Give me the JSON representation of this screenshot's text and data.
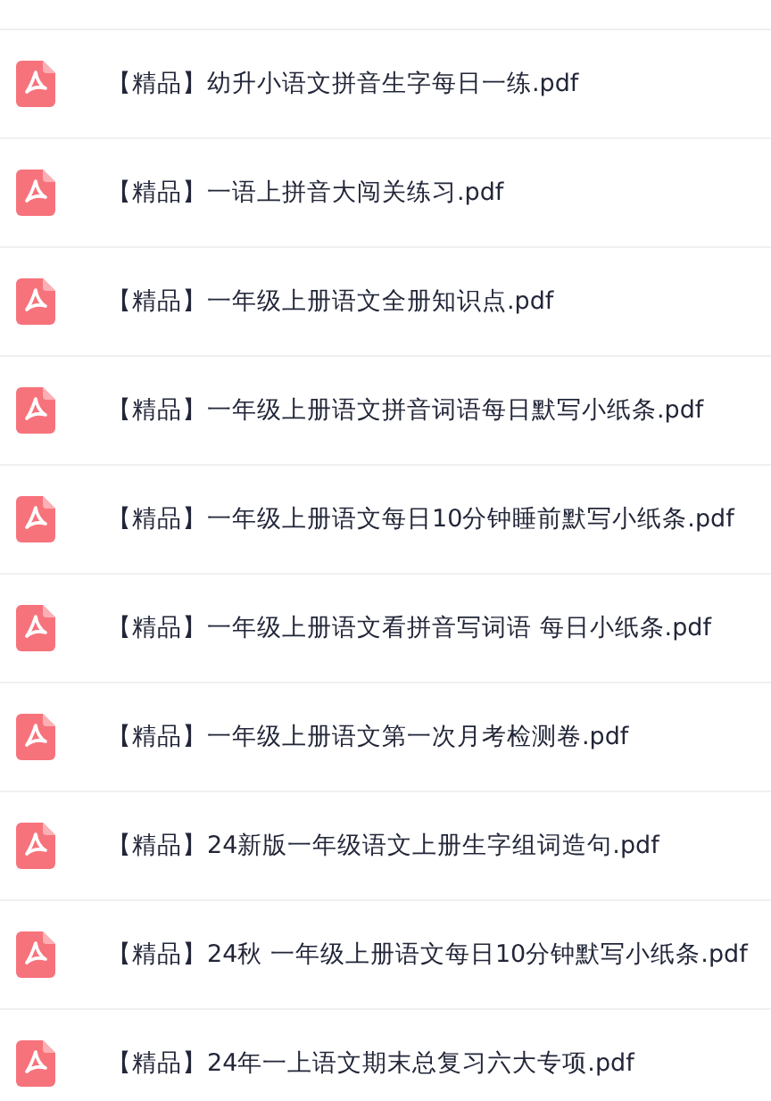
{
  "files": [
    {
      "name": "【精品】幼升小语文拼音生字每日一练.pdf"
    },
    {
      "name": "【精品】一语上拼音大闯关练习.pdf"
    },
    {
      "name": "【精品】一年级上册语文全册知识点.pdf"
    },
    {
      "name": "【精品】一年级上册语文拼音词语每日默写小纸条.pdf"
    },
    {
      "name": "【精品】一年级上册语文每日10分钟睡前默写小纸条.pdf"
    },
    {
      "name": "【精品】一年级上册语文看拼音写词语 每日小纸条.pdf"
    },
    {
      "name": "【精品】一年级上册语文第一次月考检测卷.pdf"
    },
    {
      "name": "【精品】24新版一年级语文上册生字组词造句.pdf"
    },
    {
      "name": "【精品】24秋 一年级上册语文每日10分钟默写小纸条.pdf"
    },
    {
      "name": "【精品】24年一上语文期末总复习六大专项.pdf"
    }
  ]
}
